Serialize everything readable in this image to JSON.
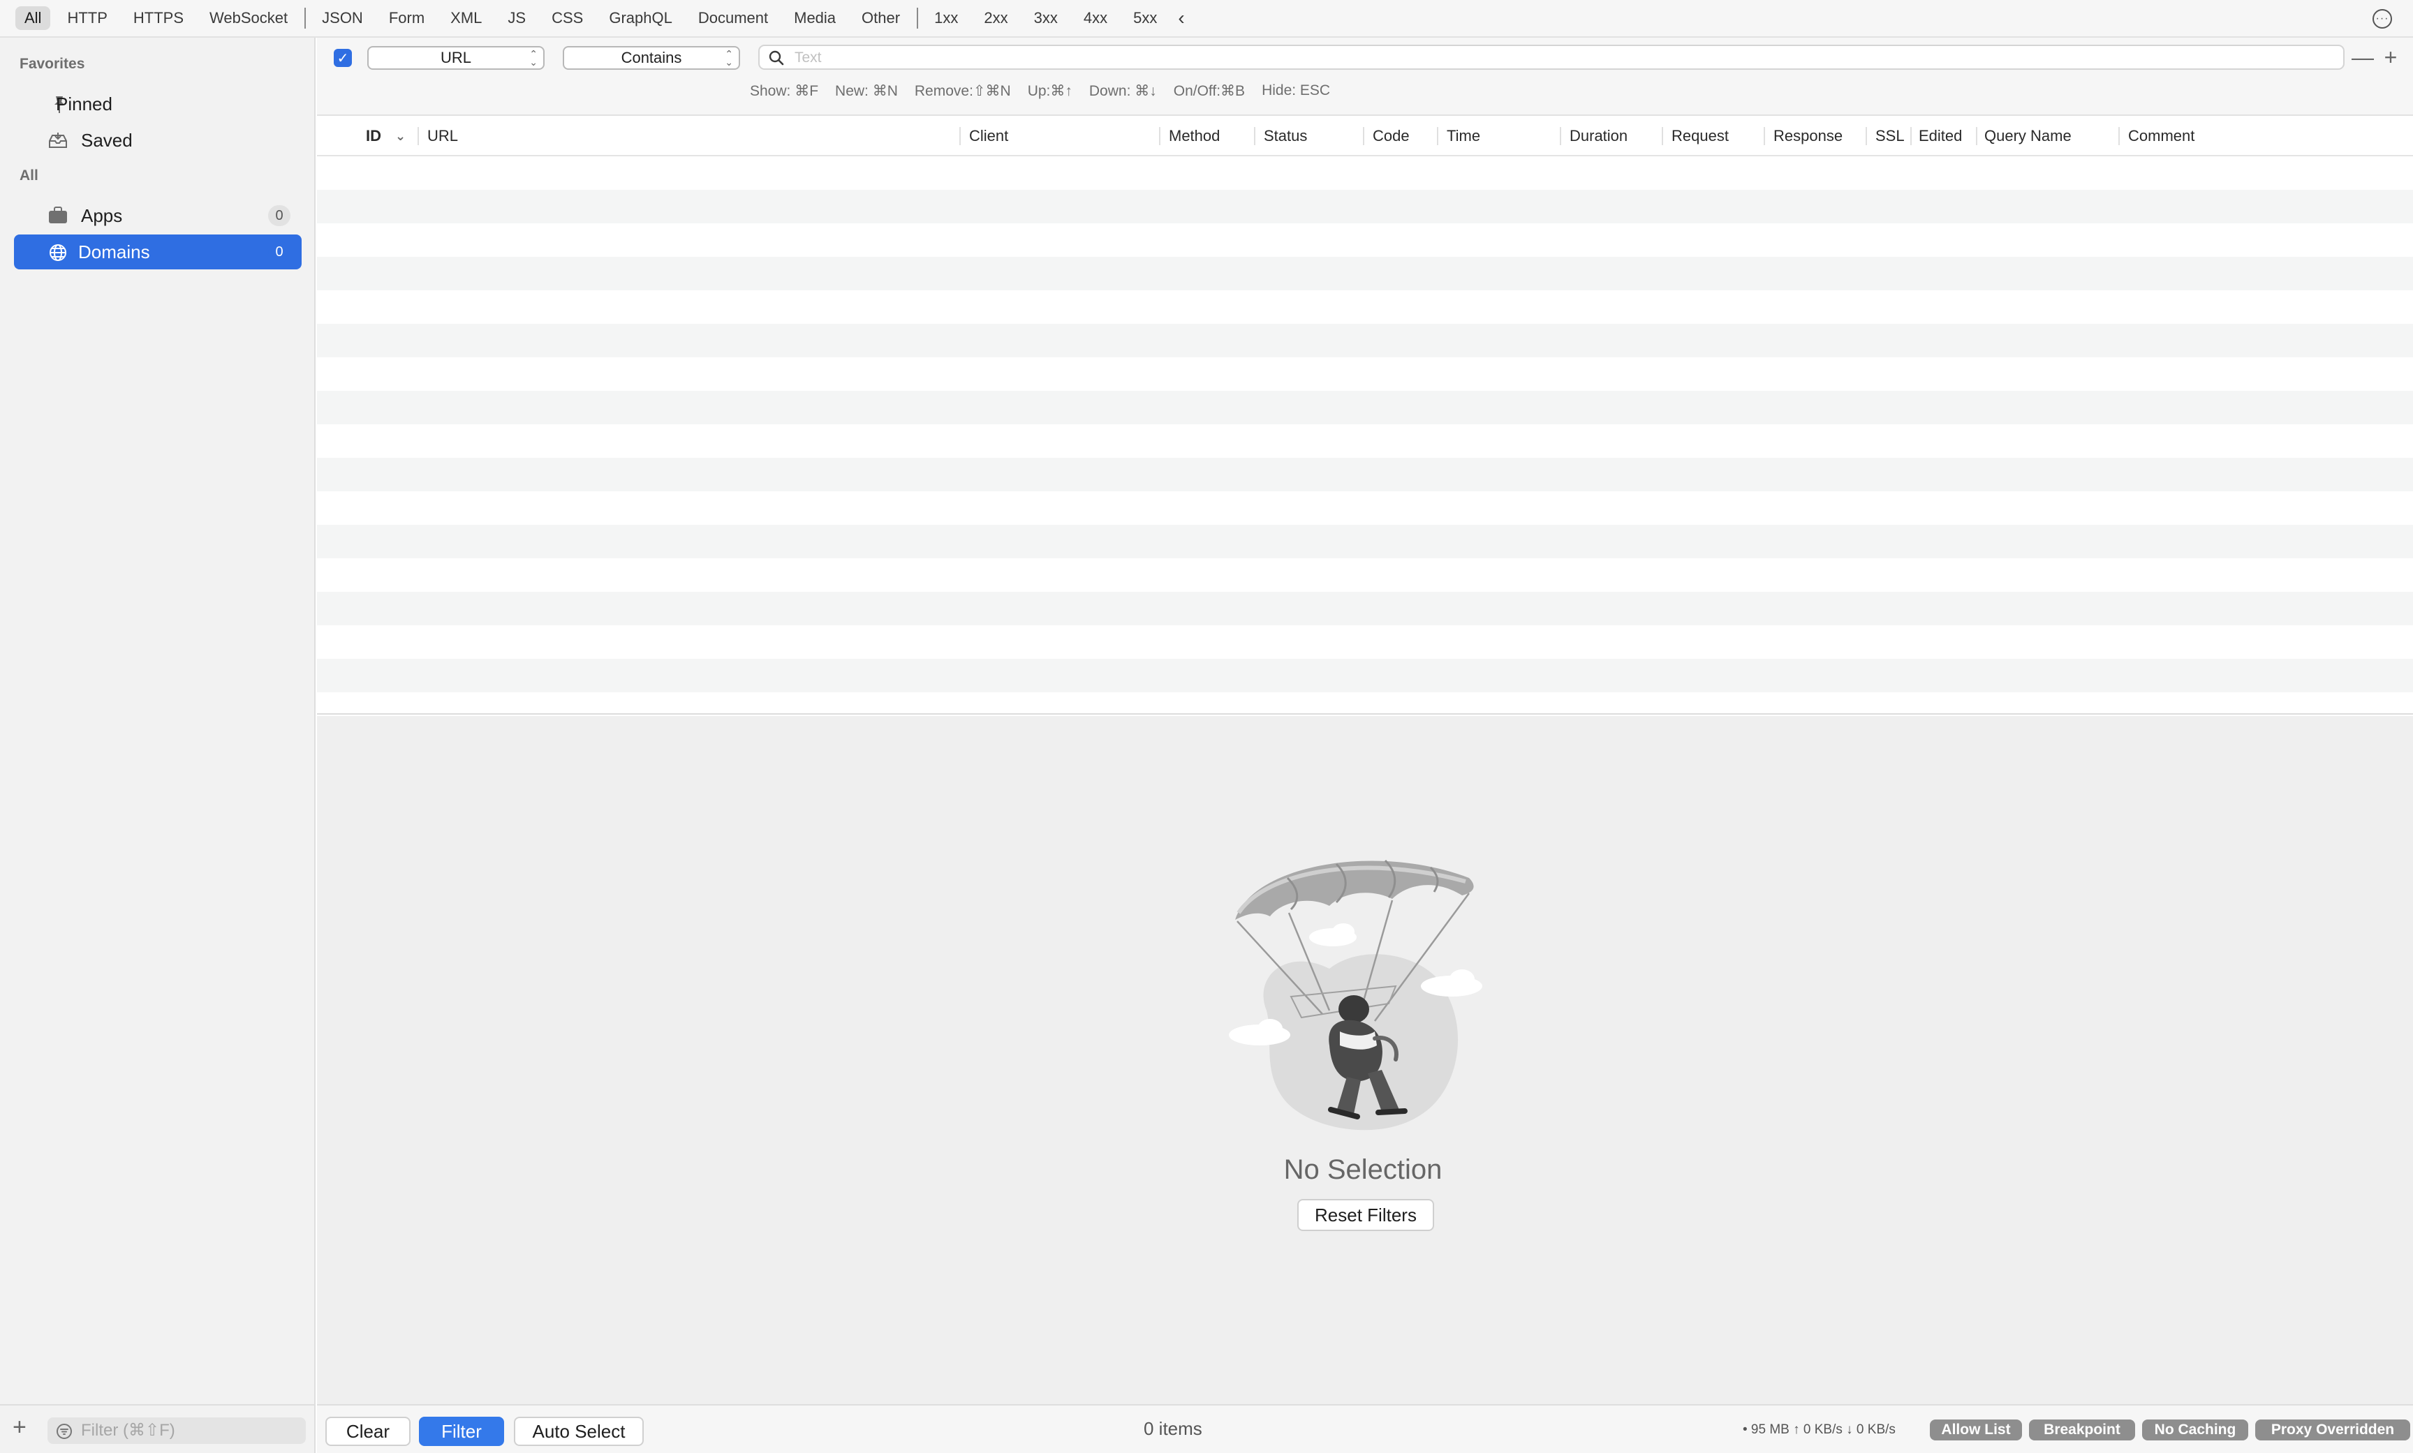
{
  "top_filters": {
    "content_types": [
      "All",
      "HTTP",
      "HTTPS",
      "WebSocket"
    ],
    "formats": [
      "JSON",
      "Form",
      "XML",
      "JS",
      "CSS",
      "GraphQL",
      "Document",
      "Media",
      "Other"
    ],
    "status_codes": [
      "1xx",
      "2xx",
      "3xx",
      "4xx",
      "5xx"
    ],
    "collapse_glyph": "‹",
    "more_glyph": "···"
  },
  "sidebar": {
    "favorites_header": "Favorites",
    "pinned_label": "Pinned",
    "saved_label": "Saved",
    "all_header": "All",
    "apps_label": "Apps",
    "apps_count": "0",
    "domains_label": "Domains",
    "domains_count": "0",
    "filter_placeholder": "Filter (⌘⇧F)",
    "add_glyph": "+"
  },
  "filter_row": {
    "field_select": "URL",
    "operator_select": "Contains",
    "search_placeholder": "Text",
    "remove_glyph": "—",
    "add_glyph": "+",
    "shortcuts": [
      "Show: ⌘F",
      "New: ⌘N",
      "Remove:⇧⌘N",
      "Up:⌘↑",
      "Down: ⌘↓",
      "On/Off:⌘B",
      "Hide: ESC"
    ]
  },
  "table": {
    "columns": [
      "ID",
      "URL",
      "Client",
      "Method",
      "Status",
      "Code",
      "Time",
      "Duration",
      "Request",
      "Response",
      "SSL",
      "Edited",
      "Query Name",
      "Comment"
    ],
    "sort_glyph": "⌄",
    "rows": []
  },
  "detail": {
    "empty_title": "No Selection",
    "reset_button": "Reset Filters"
  },
  "bottom_bar": {
    "clear_button": "Clear",
    "filter_button": "Filter",
    "auto_select_button": "Auto Select",
    "items_count": "0 items",
    "net_stats": "• 95 MB ↑ 0 KB/s ↓ 0 KB/s",
    "badges": [
      "Allow List",
      "Breakpoint",
      "No Caching",
      "Proxy Overridden"
    ]
  },
  "colors": {
    "accent": "#2f6ee2",
    "badge_bg": "#8e8e8e"
  }
}
